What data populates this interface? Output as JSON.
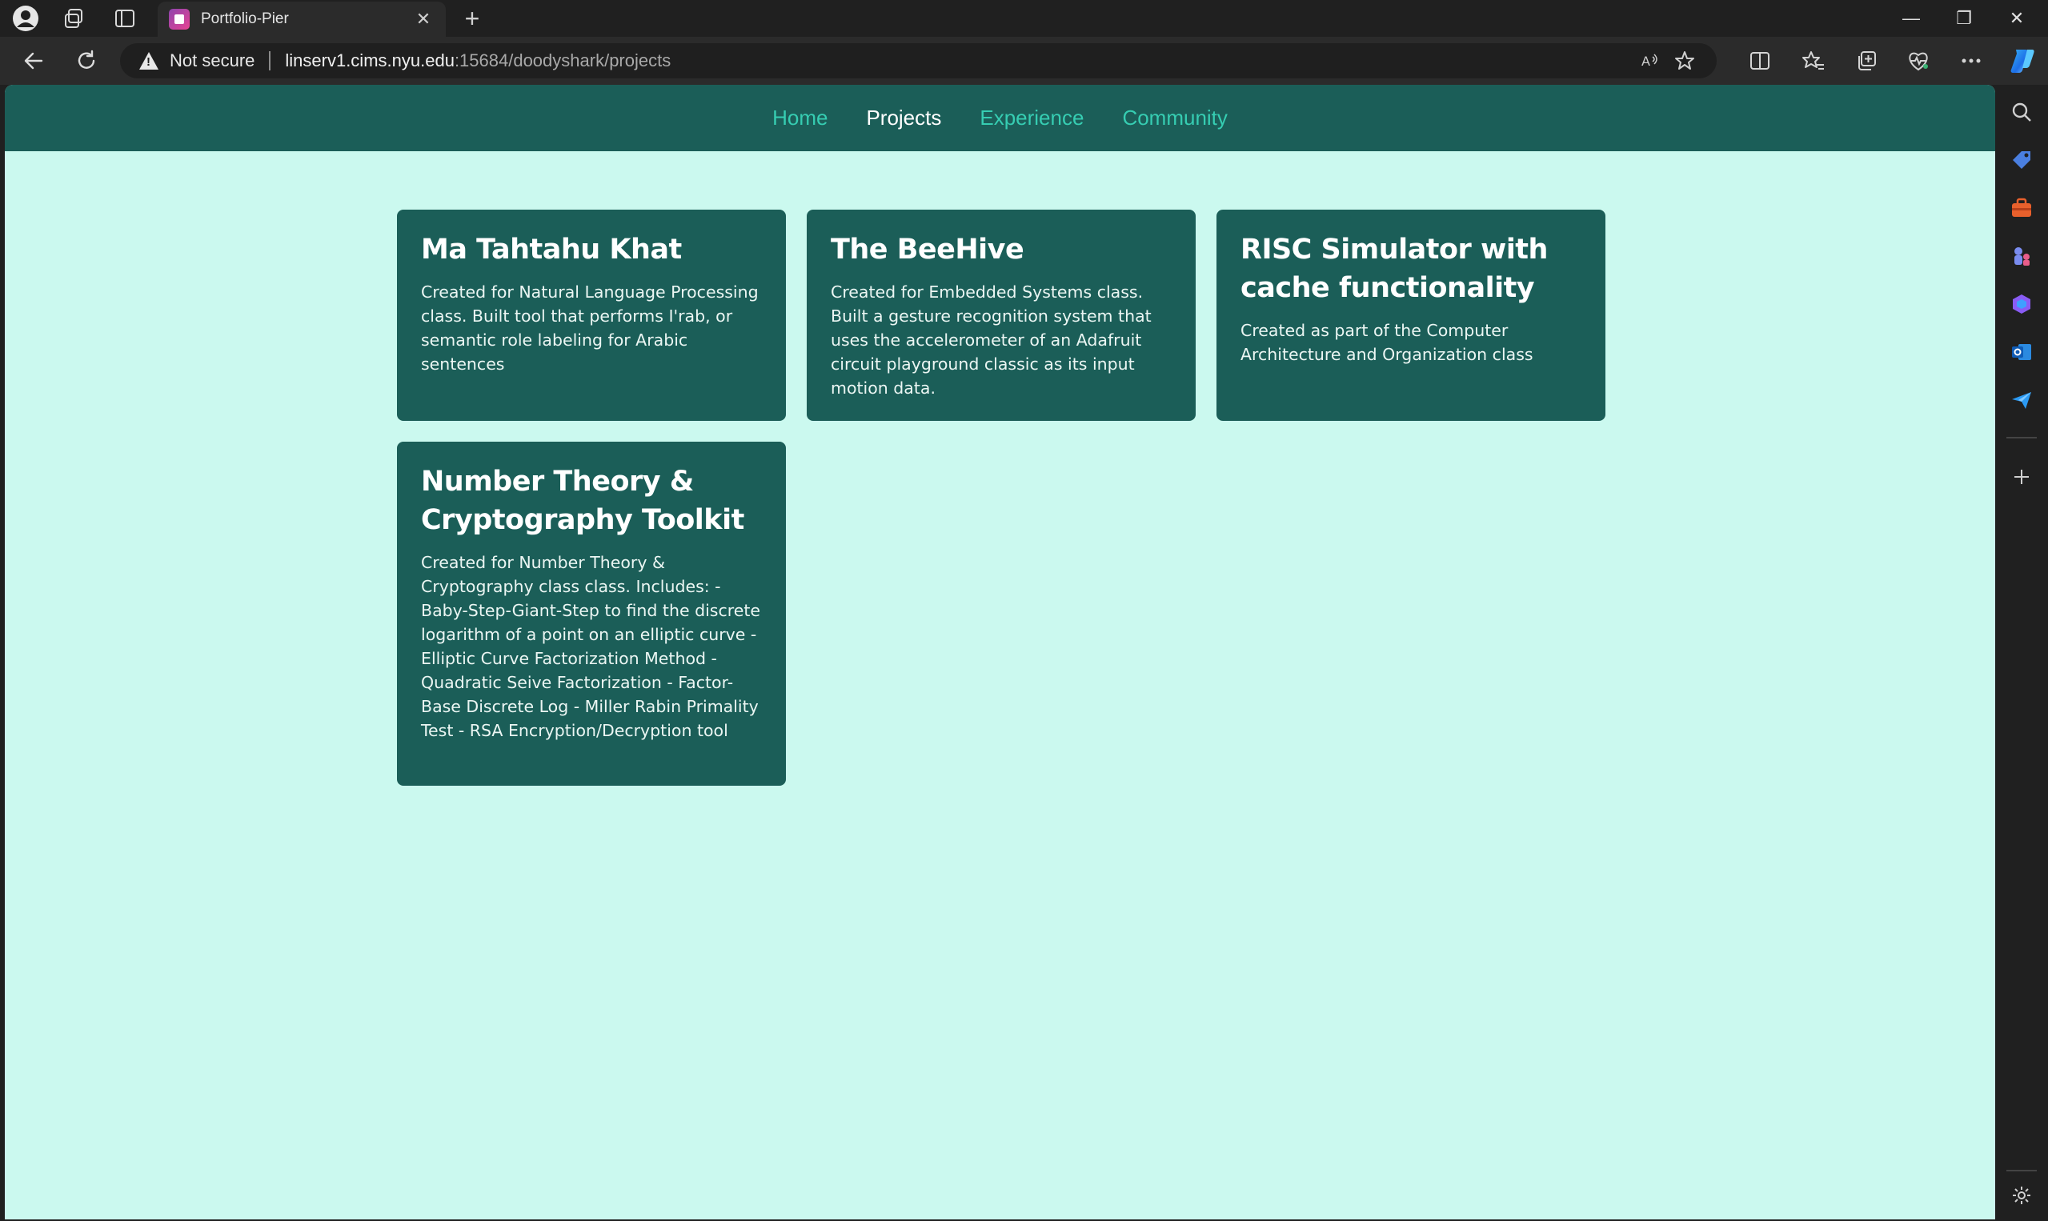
{
  "browser": {
    "tab_title": "Portfolio-Pier",
    "tab_close": "✕",
    "new_tab": "+",
    "security_label": "Not secure",
    "url_host": "linserv1.cims.nyu.edu",
    "url_path": ":15684/doodyshark/projects",
    "window_controls": {
      "minimize": "—",
      "restore": "❐",
      "close": "✕"
    }
  },
  "site": {
    "nav": {
      "items": [
        {
          "label": "Home"
        },
        {
          "label": "Projects"
        },
        {
          "label": "Experience"
        },
        {
          "label": "Community"
        }
      ],
      "active": "Projects"
    },
    "projects": [
      {
        "title": "Ma Tahtahu Khat",
        "description": "Created for Natural Language Processing class. Built tool that performs I'rab, or semantic role labeling for Arabic sentences"
      },
      {
        "title": "The BeeHive",
        "description": "Created for Embedded Systems class. Built a gesture recognition system that uses the accelerometer of an Adafruit circuit playground classic as its input motion data."
      },
      {
        "title": "RISC Simulator with cache functionality",
        "description": "Created as part of the Computer Architecture and Organization class"
      },
      {
        "title": "Number Theory & Cryptography Toolkit",
        "description": "Created for Number Theory & Cryptography class class. Includes: - Baby-Step-Giant-Step to find the discrete logarithm of a point on an elliptic curve - Elliptic Curve Factorization Method - Quadratic Seive Factorization - Factor-Base Discrete Log - Miller Rabin Primality Test - RSA Encryption/Decryption tool"
      }
    ]
  },
  "colors": {
    "page_background": "#cbf9ef",
    "nav_background": "#1b5e58",
    "card_background": "#1b5e58",
    "nav_link": "#36cdb2",
    "nav_link_active": "#ffffff"
  }
}
